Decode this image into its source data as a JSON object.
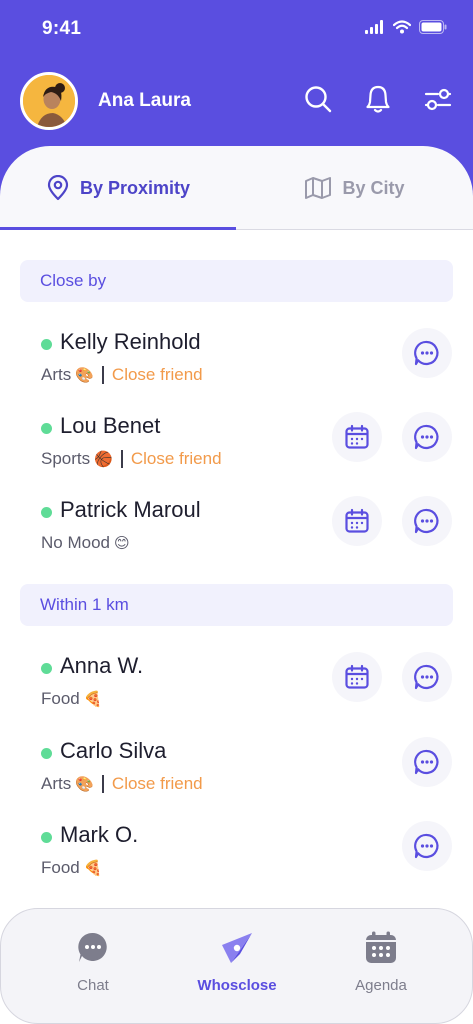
{
  "status_bar": {
    "time": "9:41"
  },
  "header": {
    "user_name": "Ana Laura"
  },
  "tabs": [
    {
      "label": "By Proximity",
      "icon": "location-pin-icon",
      "active": true
    },
    {
      "label": "By City",
      "icon": "map-icon",
      "active": false
    }
  ],
  "sections": [
    {
      "label": "Close by",
      "people": [
        {
          "name": "Kelly Reinhold",
          "category": "Arts",
          "emoji": "🎨",
          "tag": "Close friend",
          "has_calendar": false
        },
        {
          "name": "Lou Benet",
          "category": "Sports",
          "emoji": "🏀",
          "tag": "Close friend",
          "has_calendar": true
        },
        {
          "name": "Patrick Maroul",
          "category": "No Mood",
          "emoji": "😊",
          "tag": "",
          "has_calendar": true
        }
      ]
    },
    {
      "label": "Within 1 km",
      "people": [
        {
          "name": "Anna W.",
          "category": "Food",
          "emoji": "🍕",
          "tag": "",
          "has_calendar": true
        },
        {
          "name": "Carlo Silva",
          "category": "Arts",
          "emoji": "🎨",
          "tag": "Close friend",
          "has_calendar": false
        },
        {
          "name": "Mark O.",
          "category": "Food",
          "emoji": "🍕",
          "tag": "",
          "has_calendar": false
        }
      ]
    }
  ],
  "bottom_nav": [
    {
      "label": "Chat",
      "icon": "chat-bubble-icon",
      "active": false
    },
    {
      "label": "Whosclose",
      "icon": "compass-icon",
      "active": true
    },
    {
      "label": "Agenda",
      "icon": "calendar-icon",
      "active": false
    }
  ],
  "colors": {
    "primary": "#5a4ee0",
    "online": "#5fdc97",
    "close_friend": "#f29a4a",
    "section_bg": "#f1f1fd"
  }
}
